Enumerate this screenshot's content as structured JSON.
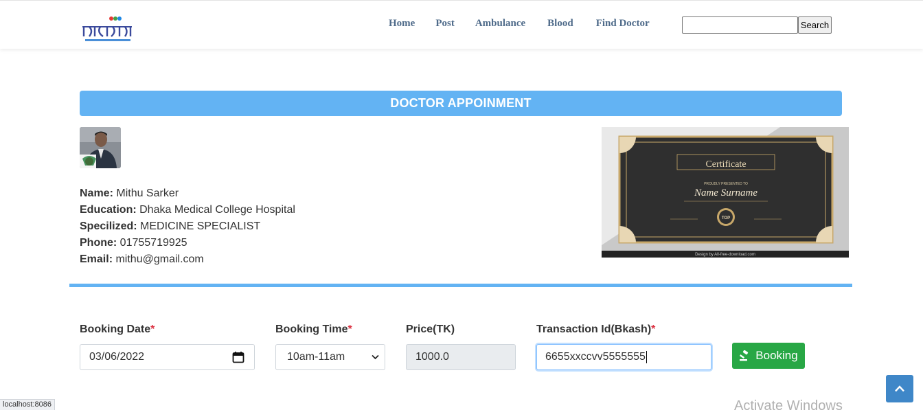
{
  "nav": {
    "links": [
      "Home",
      "Post",
      "Ambulance",
      "Blood",
      "Find Doctor"
    ],
    "search_placeholder": "",
    "search_button": "Search"
  },
  "page": {
    "heading": "DOCTOR APPOINMENT"
  },
  "doctor": {
    "name_label": "Name:",
    "name": "Mithu Sarker",
    "education_label": "Education:",
    "education": "Dhaka Medical College Hospital",
    "specialized_label": "Specilized:",
    "specialized": "MEDICINE SPECIALIST",
    "phone_label": "Phone:",
    "phone": "01755719925",
    "email_label": "Email:",
    "email": "mithu@gmail.com"
  },
  "certificate": {
    "title": "Certificate",
    "subtitle": "PROUDLY PRESENTED TO",
    "recipient": "Name Surname",
    "badge": "TOP",
    "credit": "Design by All-free-download.com"
  },
  "booking": {
    "date_label": "Booking Date",
    "date_value": "03/06/2022",
    "time_label": "Booking Time",
    "time_value": "10am-11am",
    "price_label": "Price(TK)",
    "price_value": "1000.0",
    "txn_label": "Transaction Id(Bkash)",
    "txn_value": "6655xxccvv5555555",
    "required_mark": "*",
    "button_label": "Booking"
  },
  "status_bar": {
    "url": "localhost:8086"
  },
  "watermark": "Activate Windows",
  "colors": {
    "accent": "#63b3f3",
    "success": "#28a745",
    "nav_link": "#4f6b8a",
    "required": "#dc3545"
  }
}
